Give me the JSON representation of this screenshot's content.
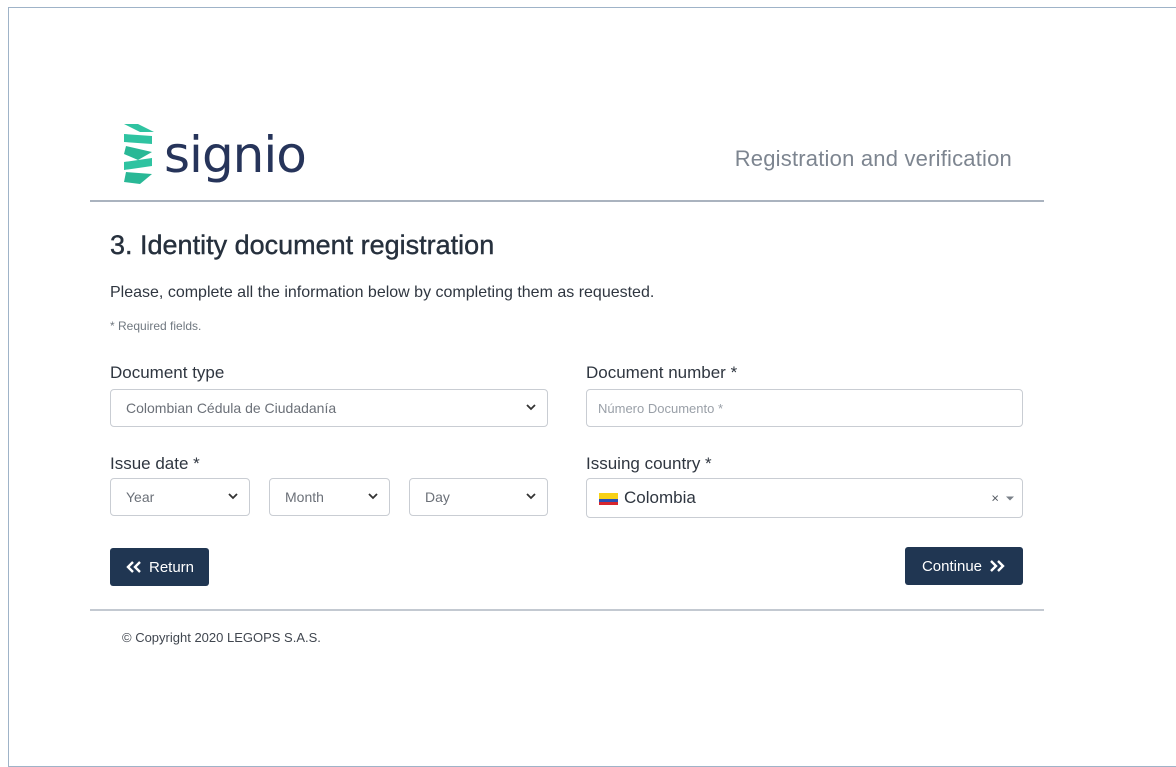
{
  "brand": {
    "name": "signio",
    "header_title": "Registration and verification",
    "colors": {
      "primary": "#203652",
      "logo_teal": "#2fc3a1",
      "logo_text": "#26345a"
    }
  },
  "page": {
    "title": "3. Identity document registration",
    "instructions": "Please, complete all the information below by completing them as requested.",
    "required_note": "* Required fields."
  },
  "form": {
    "document_type": {
      "label": "Document type",
      "value": "Colombian Cédula de Ciudadanía",
      "icon": "chevron-down-icon"
    },
    "document_number": {
      "label": "Document number *",
      "placeholder": "Número Documento *"
    },
    "issue_date": {
      "label": "Issue date *",
      "year": "Year",
      "month": "Month",
      "day": "Day"
    },
    "issuing_country": {
      "label": "Issuing country *",
      "value": "Colombia",
      "flag_icon": "colombia-flag-icon",
      "clear_symbol": "×"
    }
  },
  "buttons": {
    "return_label": "Return",
    "continue_label": "Continue"
  },
  "footer": {
    "copyright": "© Copyright 2020 LEGOPS S.A.S."
  }
}
